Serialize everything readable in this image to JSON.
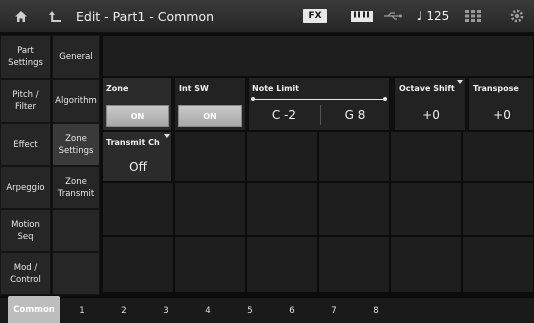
{
  "header": {
    "title": "Edit - Part1 - Common",
    "fx_label": "FX",
    "tempo": "125",
    "tempo_note": "♩",
    "icons": [
      "home-icon",
      "return-icon",
      "keyboard-icon",
      "usb-icon",
      "grid-icon",
      "gear-icon"
    ]
  },
  "menu_left": [
    {
      "label": "Part\nSettings",
      "selected": false
    },
    {
      "label": "Pitch /\nFilter",
      "selected": false
    },
    {
      "label": "Effect",
      "selected": false
    },
    {
      "label": "Arpeggio",
      "selected": false
    },
    {
      "label": "Motion\nSeq",
      "selected": false
    },
    {
      "label": "Mod /\nControl",
      "selected": false
    }
  ],
  "menu_right": [
    {
      "label": "General",
      "selected": false
    },
    {
      "label": "Algorithm",
      "selected": false
    },
    {
      "label": "Zone\nSettings",
      "selected": true
    },
    {
      "label": "Zone\nTransmit",
      "selected": false
    }
  ],
  "params": {
    "zone": {
      "label": "Zone",
      "value": "ON"
    },
    "int_sw": {
      "label": "Int SW",
      "value": "ON"
    },
    "note_limit": {
      "label": "Note Limit",
      "low": "C -2",
      "high": "G 8"
    },
    "octave_shift": {
      "label": "Octave Shift",
      "value": "+0"
    },
    "transpose": {
      "label": "Transpose",
      "value": "+0"
    },
    "transmit_ch": {
      "label": "Transmit Ch",
      "value": "Off"
    }
  },
  "bottom_tabs": [
    "Common",
    "1",
    "2",
    "3",
    "4",
    "5",
    "6",
    "7",
    "8"
  ],
  "selected_tab": "Common"
}
